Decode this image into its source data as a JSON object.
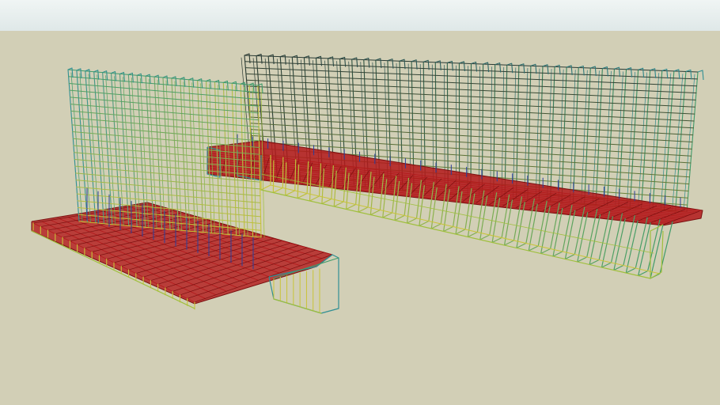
{
  "scene": {
    "sky_color_top": "#f0f5f4",
    "sky_color_bottom": "#dfe8e8",
    "ground_color": "#d2cfb6",
    "rebar_colors": {
      "red": "#b3181a",
      "dark_red": "#7a1010",
      "yellow": "#c9c438",
      "yellow_green": "#9fbf3c",
      "green": "#3f9b6a",
      "teal": "#2f8f94",
      "blue": "#2b3f9c",
      "dark": "#2a3a33"
    },
    "objects": [
      {
        "name": "large-rebar-cage"
      },
      {
        "name": "small-rebar-cage"
      }
    ]
  }
}
